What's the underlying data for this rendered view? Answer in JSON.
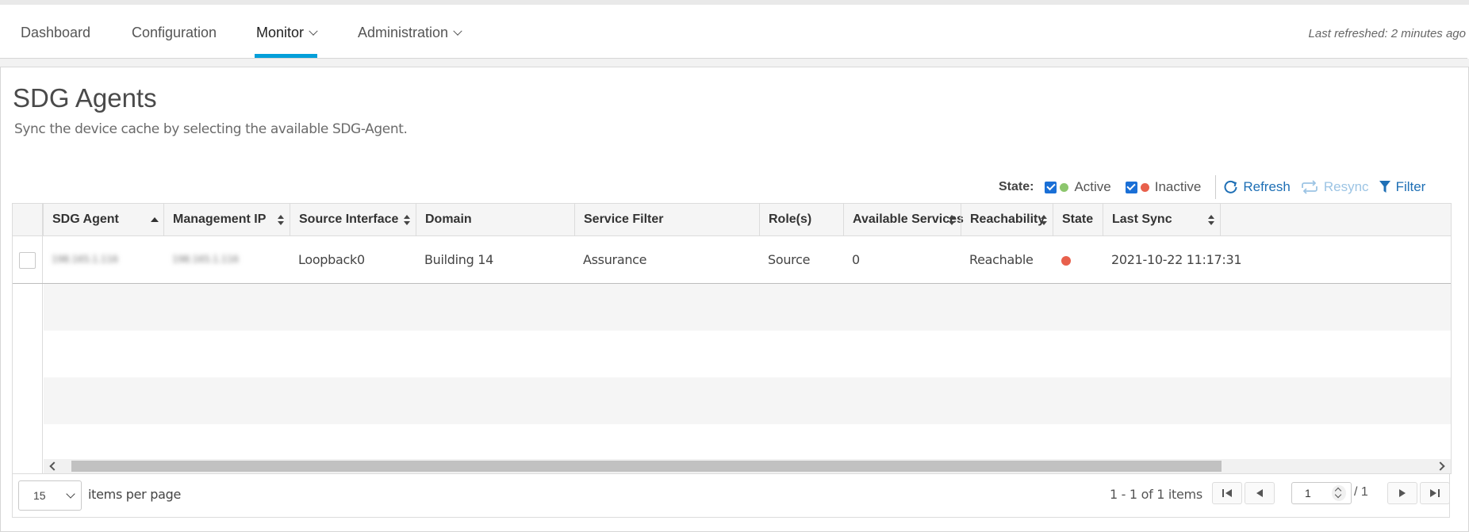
{
  "nav": {
    "items": [
      {
        "label": "Dashboard"
      },
      {
        "label": "Configuration"
      },
      {
        "label": "Monitor"
      },
      {
        "label": "Administration"
      }
    ],
    "active": "Monitor",
    "last_refreshed": "Last refreshed: 2 minutes ago"
  },
  "page": {
    "title": "SDG Agents",
    "subtitle": "Sync the device cache by selecting the available SDG-Agent."
  },
  "toolbar": {
    "state_label": "State:",
    "active_label": "Active",
    "inactive_label": "Inactive",
    "refresh_label": "Refresh",
    "resync_label": "Resync",
    "filter_label": "Filter",
    "colors": {
      "active": "#8cc66d",
      "inactive": "#e8604c",
      "accent": "#1e6fb5"
    }
  },
  "table": {
    "columns": [
      "SDG Agent",
      "Management IP",
      "Source Interface",
      "Domain",
      "Service Filter",
      "Role(s)",
      "Available Services",
      "Reachability",
      "State",
      "Last Sync"
    ],
    "rows": [
      {
        "sdg_agent": "198.165.1.116",
        "management_ip": "198.165.1.116",
        "source_interface": "Loopback0",
        "domain": "Building 14",
        "service_filter": "Assurance",
        "roles": "Source",
        "available_services": "0",
        "reachability": "Reachable",
        "state": "inactive",
        "last_sync": "2021-10-22 11:17:31"
      }
    ]
  },
  "pagination": {
    "page_size": "15",
    "items_per_page_label": "items per page",
    "range_text": "1 - 1 of 1 items",
    "current_page": "1",
    "total_pages_text": "/ 1"
  }
}
